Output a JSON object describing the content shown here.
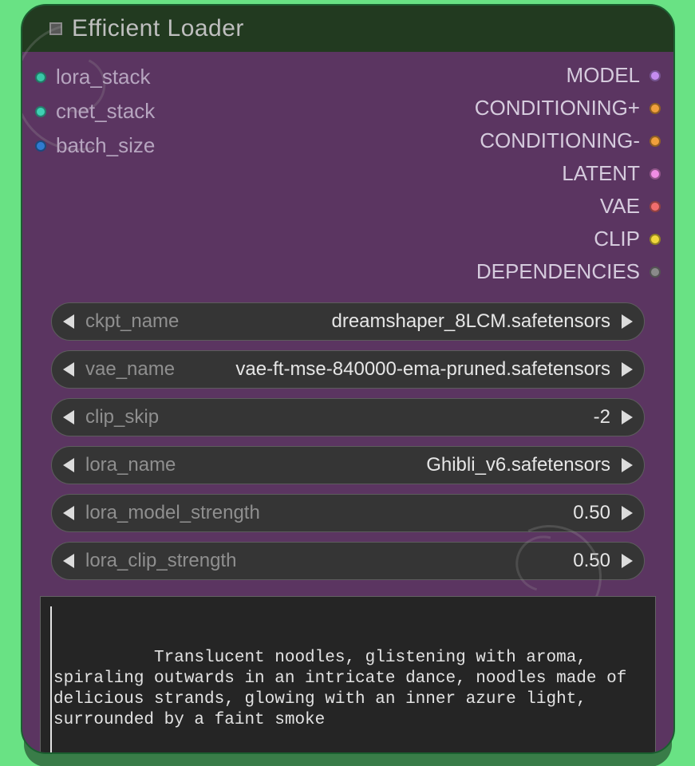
{
  "title": "Efficient Loader",
  "inputs": [
    {
      "name": "lora_stack",
      "color": "#39c6a7"
    },
    {
      "name": "cnet_stack",
      "color": "#3fd0b4"
    },
    {
      "name": "batch_size",
      "color": "#2f7bd1"
    }
  ],
  "outputs": [
    {
      "name": "MODEL",
      "color": "#c48cf0"
    },
    {
      "name": "CONDITIONING+",
      "color": "#f0a03c"
    },
    {
      "name": "CONDITIONING-",
      "color": "#f0a03c"
    },
    {
      "name": "LATENT",
      "color": "#f08de4"
    },
    {
      "name": "VAE",
      "color": "#f06d6d"
    },
    {
      "name": "CLIP",
      "color": "#f0d83c"
    },
    {
      "name": "DEPENDENCIES",
      "color": "#8a8a8a"
    }
  ],
  "widgets": {
    "ckpt_name": {
      "label": "ckpt_name",
      "value": "dreamshaper_8LCM.safetensors"
    },
    "vae_name": {
      "label": "vae_name",
      "value": "vae-ft-mse-840000-ema-pruned.safetensors"
    },
    "clip_skip": {
      "label": "clip_skip",
      "value": "-2"
    },
    "lora_name": {
      "label": "lora_name",
      "value": "Ghibli_v6.safetensors"
    },
    "lora_model_strength": {
      "label": "lora_model_strength",
      "value": "0.50"
    },
    "lora_clip_strength": {
      "label": "lora_clip_strength",
      "value": "0.50"
    }
  },
  "prompt": "Translucent noodles, glistening with aroma, spiraling outwards in an intricate dance, noodles made of delicious strands, glowing with an inner azure light, surrounded by a faint smoke"
}
